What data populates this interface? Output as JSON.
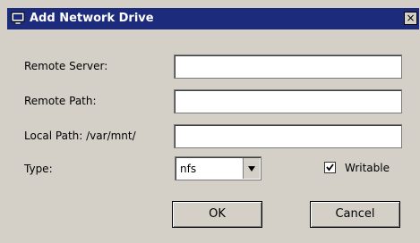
{
  "window": {
    "title": "Add Network Drive",
    "close_glyph": "×",
    "icon": "monitor-icon"
  },
  "form": {
    "remote_server_label": "Remote Server:",
    "remote_server_value": "",
    "remote_path_label": "Remote Path:",
    "remote_path_value": "",
    "local_path_label": "Local Path: /var/mnt/",
    "local_path_value": "",
    "type_label": "Type:",
    "type_value": "nfs",
    "writable_label": "Writable",
    "writable_checked": true
  },
  "buttons": {
    "ok_label": "OK",
    "cancel_label": "Cancel"
  },
  "colors": {
    "titlebar": "#1d2b7c",
    "dialog_bg": "#d4d0c8"
  }
}
